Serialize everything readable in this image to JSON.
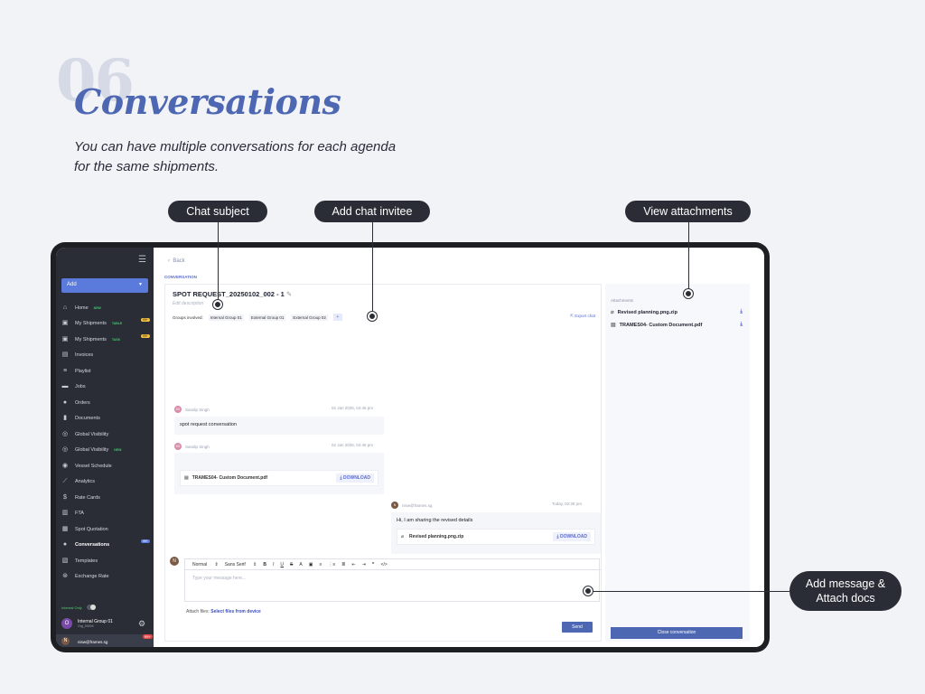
{
  "section_number": "06",
  "heading": "Conversations",
  "subtitle": "You can have multiple conversations for each agenda for the same shipments.",
  "callouts": {
    "chat_subject": "Chat subject",
    "add_invitee": "Add chat invitee",
    "view_attachments": "View attachments",
    "add_message_line1": "Add message &",
    "add_message_line2": "Attach docs"
  },
  "sidebar": {
    "add_label": "Add",
    "items": [
      {
        "icon": "home-icon",
        "label": "Home",
        "badge": "NEW"
      },
      {
        "icon": "briefcase-icon",
        "label": "My Shipments",
        "badge": "TABLE",
        "pill": "99+"
      },
      {
        "icon": "briefcase-icon",
        "label": "My Shipments",
        "badge": "TASK",
        "pill": "99+"
      },
      {
        "icon": "invoice-icon",
        "label": "Invoices"
      },
      {
        "icon": "playlist-icon",
        "label": "Playlist"
      },
      {
        "icon": "jobs-icon",
        "label": "Jobs"
      },
      {
        "icon": "orders-icon",
        "label": "Orders"
      },
      {
        "icon": "documents-icon",
        "label": "Documents"
      },
      {
        "icon": "globe-icon",
        "label": "Global Visibility"
      },
      {
        "icon": "globe-icon",
        "label": "Global Visibility",
        "badge": "NEW"
      },
      {
        "icon": "vessel-icon",
        "label": "Vessel Schedule"
      },
      {
        "icon": "analytics-icon",
        "label": "Analytics"
      },
      {
        "icon": "dollar-icon",
        "label": "Rate Cards"
      },
      {
        "icon": "fta-icon",
        "label": "FTA"
      },
      {
        "icon": "quotation-icon",
        "label": "Spot Quotation"
      },
      {
        "icon": "chat-icon",
        "label": "Conversations",
        "pill": "99+"
      },
      {
        "icon": "templates-icon",
        "label": "Templates"
      },
      {
        "icon": "exchange-icon",
        "label": "Exchange Rate"
      }
    ],
    "internal_only": "Internal Only",
    "org_initial": "O",
    "org_name": "Internal Group 01",
    "org_sub": "Org_00004",
    "user_initial": "N",
    "user_email": "nisw@frames.sg",
    "notif_count": "99+"
  },
  "main": {
    "back": "Back",
    "section_label": "CONVERSATION",
    "title": "SPOT REQUEST_20250102_002 - 1",
    "edit_description": "Edit description",
    "groups_label": "Groups involved:",
    "groups": [
      "Internal Group 01",
      "External Group 01",
      "External Group 02"
    ],
    "export": "Export chat",
    "messages": [
      {
        "avatar": "SS",
        "author": "Sandip Singh",
        "time": "02 Jan 2025, 04:46 pm",
        "text": "spot request conversation"
      },
      {
        "avatar": "SS",
        "author": "Sandip Singh",
        "time": "02 Jan 2025, 04:46 pm",
        "file": "TRAMES04- Custom Document.pdf",
        "download": "DOWNLOAD"
      },
      {
        "avatar": "N",
        "author": "nisw@frames.sg",
        "time": "Today, 02:28 pm",
        "text": "Hi, I am sharing the revised details",
        "file": "Revised planning.png.zip",
        "download": "DOWNLOAD"
      }
    ],
    "editor": {
      "avatar": "N",
      "format": "Normal",
      "font": "Sans Serif",
      "placeholder": "Type your message here...",
      "attach_label": "Attach files:",
      "attach_link": "Select files from device",
      "send": "Send"
    }
  },
  "attachments": {
    "header": "Attachments",
    "items": [
      "Revised planning.png.zip",
      "TRAMES04- Custom Document.pdf"
    ],
    "close": "Close conversation"
  }
}
